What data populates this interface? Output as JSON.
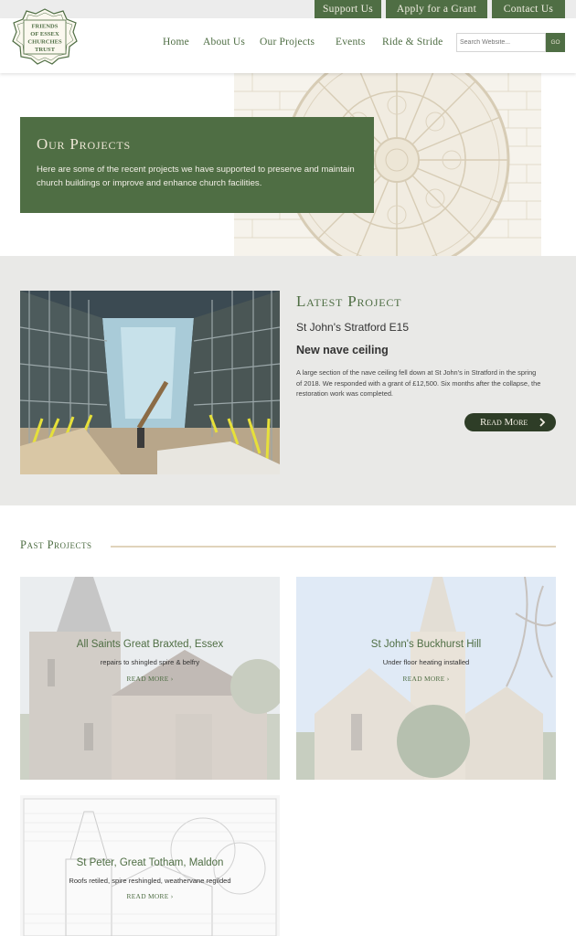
{
  "topbar": {
    "support": "Support Us",
    "grant": "Apply for a Grant",
    "contact": "Contact Us"
  },
  "logo": {
    "line1": "FRIENDS",
    "line2": "OF ESSEX",
    "line3": "CHURCHES",
    "line4": "TRUST"
  },
  "nav": {
    "home": "Home",
    "about": "About Us",
    "projects": "Our Projects",
    "events": "Events",
    "ride": "Ride & Stride"
  },
  "search": {
    "placeholder": "Search Website...",
    "button": "GO"
  },
  "hero": {
    "title": "Our Projects",
    "text": "Here are some of the recent projects we have supported to preserve and maintain church buildings or improve and enhance church facilities."
  },
  "latest": {
    "heading": "Latest Project",
    "church": "St John's Stratford E15",
    "title": "New nave ceiling",
    "description": "A large section of the nave ceiling fell down at St John's in Stratford in the spring of 2018. We responded with a grant of £12,500. Six months after the collapse, the restoration work was completed.",
    "button": "Read More"
  },
  "past": {
    "heading": "Past Projects",
    "projects": [
      {
        "title": "All Saints Great Braxted, Essex",
        "subtitle": "repairs to shingled spire & belfry",
        "more": "READ MORE"
      },
      {
        "title": "St John's Buckhurst Hill",
        "subtitle": "Under floor heating installed",
        "more": "READ MORE"
      },
      {
        "title": "St Peter, Great Totham, Maldon",
        "subtitle": "Roofs retiled, spire reshingled, weathervane regilded",
        "more": "READ MORE"
      }
    ]
  },
  "colors": {
    "brand_green": "#4f6e44",
    "dark_green": "#2e3d27",
    "cream": "#eee7d6",
    "rule_tan": "#e0d3bb"
  },
  "icons": {
    "readmore": "chevron-right-icon",
    "card_more": "chevron-right-icon"
  }
}
